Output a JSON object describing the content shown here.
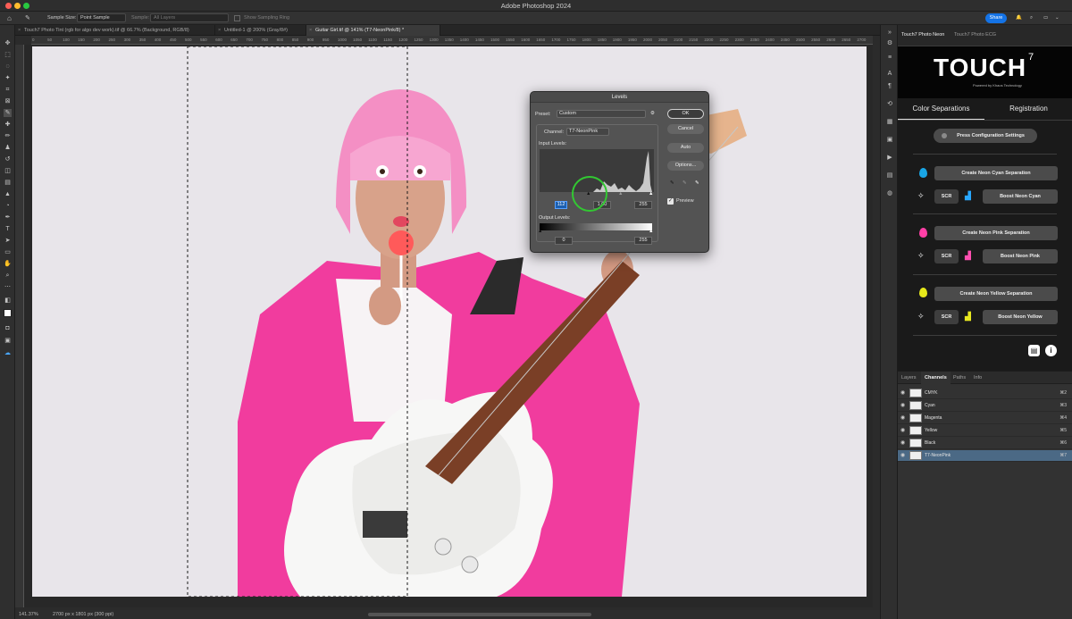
{
  "app": {
    "title": "Adobe Photoshop 2024"
  },
  "options_bar": {
    "sample_size_label": "Sample Size:",
    "sample_size_value": "Point Sample",
    "sample_label": "Sample:",
    "sample_value": "All Layers",
    "show_sampling_ring": "Show Sampling Ring",
    "share_label": "Share"
  },
  "tabs": [
    {
      "label": "Touch7 Photo Tint (rgb for algo dev work).tif @ 66.7% (Background, RGB/8)",
      "active": false
    },
    {
      "label": "Untitled-1 @ 200% (Gray/8#)",
      "active": false
    },
    {
      "label": "Guitar Girl.tif @ 141% (T7-NeonPink/8) *",
      "active": true
    }
  ],
  "ruler": {
    "h_ticks": [
      "0",
      "50",
      "100",
      "150",
      "200",
      "250",
      "300",
      "350",
      "400",
      "450",
      "500",
      "550",
      "600",
      "650",
      "700",
      "750",
      "800",
      "850",
      "900",
      "950",
      "1000",
      "1050",
      "1100",
      "1150",
      "1200",
      "1250",
      "1300",
      "1350",
      "1400",
      "1450",
      "1500",
      "1550",
      "1600",
      "1650",
      "1700",
      "1750",
      "1800",
      "1850",
      "1900",
      "1950",
      "2000",
      "2050",
      "2100",
      "2150",
      "2200",
      "2250",
      "2300",
      "2350",
      "2400",
      "2450",
      "2500",
      "2550",
      "2600",
      "2650",
      "2700"
    ]
  },
  "status": {
    "zoom": "141.37%",
    "doc_info": "2700 px x 1801 px (300 ppi)"
  },
  "levels": {
    "title": "Levels",
    "preset_label": "Preset:",
    "preset_value": "Custom",
    "channel_label": "Channel:",
    "channel_value": "T7-NeonPink",
    "input_levels_label": "Input Levels:",
    "input_black": "112",
    "input_gamma": "1.00",
    "input_white": "255",
    "output_levels_label": "Output Levels:",
    "output_black": "0",
    "output_white": "255",
    "ok_label": "OK",
    "cancel_label": "Cancel",
    "auto_label": "Auto",
    "options_label": "Options...",
    "preview_label": "Preview",
    "preview_checked": true
  },
  "touch7": {
    "tabs": [
      "Touch7 Photo Neon",
      "Touch7 Photo ECG"
    ],
    "logo_text": "TOUCH",
    "logo_super": "7",
    "logo_tagline": "Powered by Khaos Technology",
    "subtabs": [
      "Color Separations",
      "Registration"
    ],
    "config_button": "Press Configuration Settings",
    "groups": [
      {
        "drop_color": "#19a6e6",
        "create_label": "Create Neon Cyan Separation",
        "scr_label": "SCR",
        "boost_label": "Boost Neon Cyan",
        "accent": "#28a7ff"
      },
      {
        "drop_color": "#ff3fa6",
        "create_label": "Create Neon Pink Separation",
        "scr_label": "SCR",
        "boost_label": "Boost Neon Pink",
        "accent": "#ff4fb0"
      },
      {
        "drop_color": "#e6e81a",
        "create_label": "Create Neon Yellow Separation",
        "scr_label": "SCR",
        "boost_label": "Boost Neon Yellow",
        "accent": "#e8e820"
      }
    ]
  },
  "channels_panel": {
    "tabs": [
      "Layers",
      "Channels",
      "Paths",
      "Info"
    ],
    "active_tab": "Channels",
    "rows": [
      {
        "name": "CMYK",
        "key": "⌘2"
      },
      {
        "name": "Cyan",
        "key": "⌘3"
      },
      {
        "name": "Magenta",
        "key": "⌘4"
      },
      {
        "name": "Yellow",
        "key": "⌘5"
      },
      {
        "name": "Black",
        "key": "⌘6"
      },
      {
        "name": "T7-NeonPink",
        "key": "⌘7"
      }
    ]
  }
}
